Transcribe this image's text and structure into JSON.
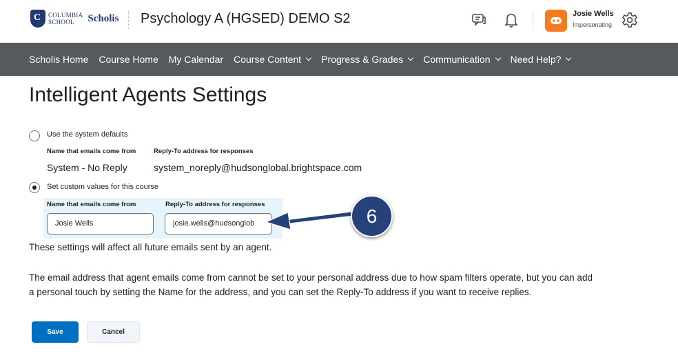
{
  "header": {
    "logo": {
      "line1": "COLUMBIA",
      "line2": "SCHOOL",
      "brand": "Scholis"
    },
    "course_title": "Psychology A (HGSED) DEMO S2",
    "icons": [
      "chat-icon",
      "bell-icon",
      "gear-icon"
    ],
    "user": {
      "name": "Josie Wells",
      "role": "Impersonating"
    }
  },
  "nav": {
    "items": [
      {
        "label": "Scholis Home",
        "dropdown": false
      },
      {
        "label": "Course Home",
        "dropdown": false
      },
      {
        "label": "My Calendar",
        "dropdown": false
      },
      {
        "label": "Course Content",
        "dropdown": true
      },
      {
        "label": "Progress & Grades",
        "dropdown": true
      },
      {
        "label": "Communication",
        "dropdown": true
      },
      {
        "label": "Need Help?",
        "dropdown": true
      }
    ]
  },
  "page": {
    "title": "Intelligent Agents Settings",
    "system_option": {
      "label": "Use the system defaults",
      "selected": false,
      "name_header": "Name that emails come from",
      "reply_header": "Reply-To address for responses",
      "name_value": "System - No Reply",
      "reply_value": "system_noreply@hudsonglobal.brightspace.com"
    },
    "custom_option": {
      "label": "Set custom values for this course",
      "selected": true,
      "name_header": "Name that emails come from",
      "reply_header": "Reply-To address for responses",
      "name_input": "Josie Wells",
      "reply_input": "josie.wells@hudsonglob"
    },
    "note": "These settings will affect all future emails sent by an agent.",
    "info_line1": "The email address that agent emails come from cannot be set to your personal address due to how spam filters operate, but you can add",
    "info_line2": "a personal touch by setting the Name for the address, and you can set the Reply-To address if you want to receive replies.",
    "save_label": "Save",
    "cancel_label": "Cancel"
  },
  "annotation": {
    "step": "6",
    "color": "#27417a"
  },
  "colors": {
    "nav_bg": "#565a5c",
    "primary": "#006fbf",
    "avatar": "#f47b20",
    "panel": "#e8f4fb"
  }
}
